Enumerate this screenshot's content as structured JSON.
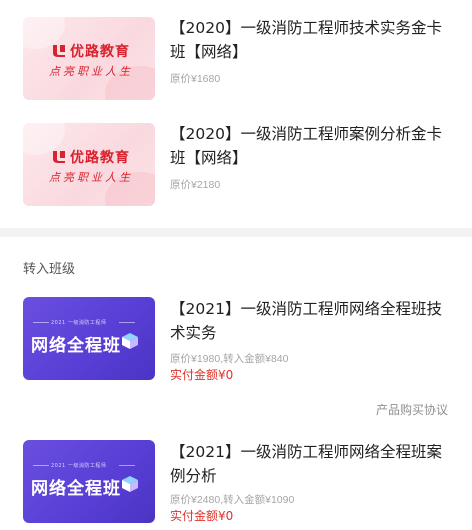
{
  "top_courses": [
    {
      "title": "【2020】一级消防工程师技术实务金卡班【网络】",
      "original_price": "原价¥1680",
      "thumbnail": {
        "brand_name": "优路教育",
        "slogan": "点亮职业人生",
        "logo_icon": "youlu-logo-icon"
      }
    },
    {
      "title": "【2020】一级消防工程师案例分析金卡班【网络】",
      "original_price": "原价¥2180",
      "thumbnail": {
        "brand_name": "优路教育",
        "slogan": "点亮职业人生",
        "logo_icon": "youlu-logo-icon"
      }
    }
  ],
  "transfer_section": {
    "header": "转入班级",
    "courses": [
      {
        "title": "【2021】一级消防工程师网络全程班技术实务",
        "price_info": "原价¥1980,转入金额¥840",
        "actual_amount": "实付金额¥0",
        "thumbnail": {
          "small_tag": "2021 一级消防工程师",
          "big_title": "网络全程班",
          "icon": "cube-icon"
        }
      },
      {
        "title": "【2021】一级消防工程师网络全程班案例分析",
        "price_info": "原价¥2480,转入金额¥1090",
        "actual_amount": "实付金额¥0",
        "thumbnail": {
          "small_tag": "2021 一级消防工程师",
          "big_title": "网络全程班",
          "icon": "cube-icon"
        }
      }
    ],
    "agreement_link": "产品购买协议"
  },
  "colors": {
    "brand_red": "#d9232e",
    "price_red": "#e0312c",
    "purple": "#5a3fd6",
    "background": "#f2f2f2"
  }
}
